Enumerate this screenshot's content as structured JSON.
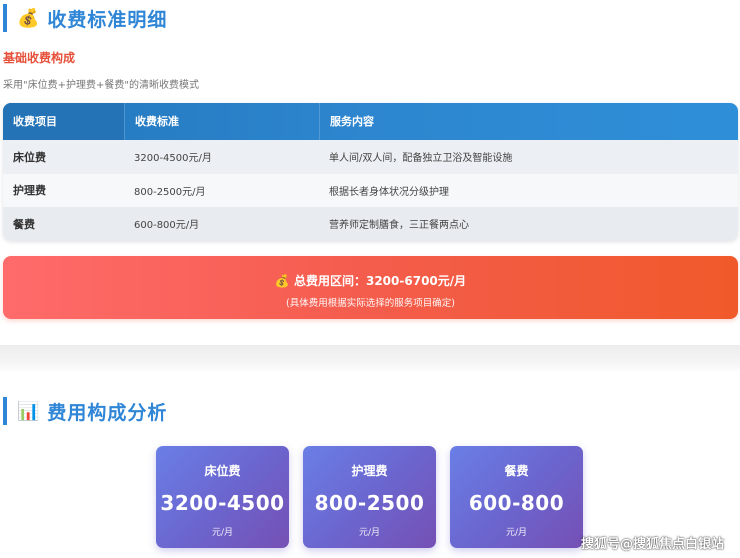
{
  "section1": {
    "icon": "money-bag-icon",
    "icon_glyph": "💰",
    "title": "收费标准明细",
    "sub_heading": "基础收费构成",
    "description": "采用\"床位费+护理费+餐费\"的清晰收费模式"
  },
  "table": {
    "headers": [
      "收费项目",
      "收费标准",
      "服务内容"
    ],
    "rows": [
      {
        "item": "床位费",
        "standard": "3200-4500元/月",
        "content": "单人间/双人间，配备独立卫浴及智能设施"
      },
      {
        "item": "护理费",
        "standard": "800-2500元/月",
        "content": "根据长者身体状况分级护理"
      },
      {
        "item": "餐费",
        "standard": "600-800元/月",
        "content": "营养师定制膳食，三正餐两点心"
      }
    ]
  },
  "total": {
    "icon_glyph": "💰",
    "text": "总费用区间：3200-6700元/月",
    "note": "(具体费用根据实际选择的服务项目确定)"
  },
  "section2": {
    "icon": "bar-chart-icon",
    "icon_glyph": "📊",
    "title": "费用构成分析"
  },
  "cards": [
    {
      "label": "床位费",
      "value": "3200-4500",
      "unit": "元/月"
    },
    {
      "label": "护理费",
      "value": "800-2500",
      "unit": "元/月"
    },
    {
      "label": "餐费",
      "value": "600-800",
      "unit": "元/月"
    }
  ],
  "watermark": "搜狐号@搜狐焦点白银站",
  "colors": {
    "accent_blue": "#2f86d6",
    "accent_red": "#e6503a",
    "banner_start": "#ff6b6b",
    "banner_end": "#f05a2a",
    "card_start": "#6a7fe6",
    "card_end": "#7550b4"
  }
}
